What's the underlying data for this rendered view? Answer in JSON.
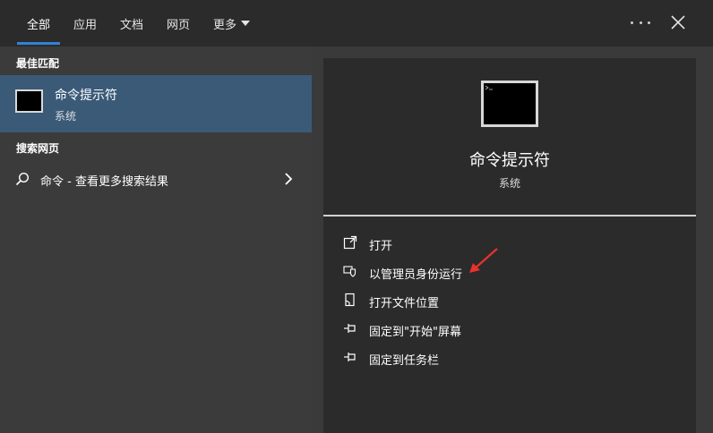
{
  "tabs": [
    {
      "label": "全部"
    },
    {
      "label": "应用"
    },
    {
      "label": "文档"
    },
    {
      "label": "网页"
    },
    {
      "label": "更多"
    }
  ],
  "left": {
    "best_match_label": "最佳匹配",
    "best_match": {
      "title": "命令提示符",
      "subtitle": "系统"
    },
    "web_label": "搜索网页",
    "web_item": {
      "text": "命令 - 查看更多搜索结果"
    }
  },
  "right": {
    "title": "命令提示符",
    "subtitle": "系统",
    "actions": [
      {
        "label": "打开",
        "icon": "open-icon"
      },
      {
        "label": "以管理员身份运行",
        "icon": "shield-icon"
      },
      {
        "label": "打开文件位置",
        "icon": "file-location-icon"
      },
      {
        "label": "固定到\"开始\"屏幕",
        "icon": "pin-icon"
      },
      {
        "label": "固定到任务栏",
        "icon": "pin-icon"
      }
    ]
  },
  "colors": {
    "accent": "#2f84d6",
    "selected_bg": "#3a5a78",
    "annotation_arrow": "#e8322b"
  }
}
